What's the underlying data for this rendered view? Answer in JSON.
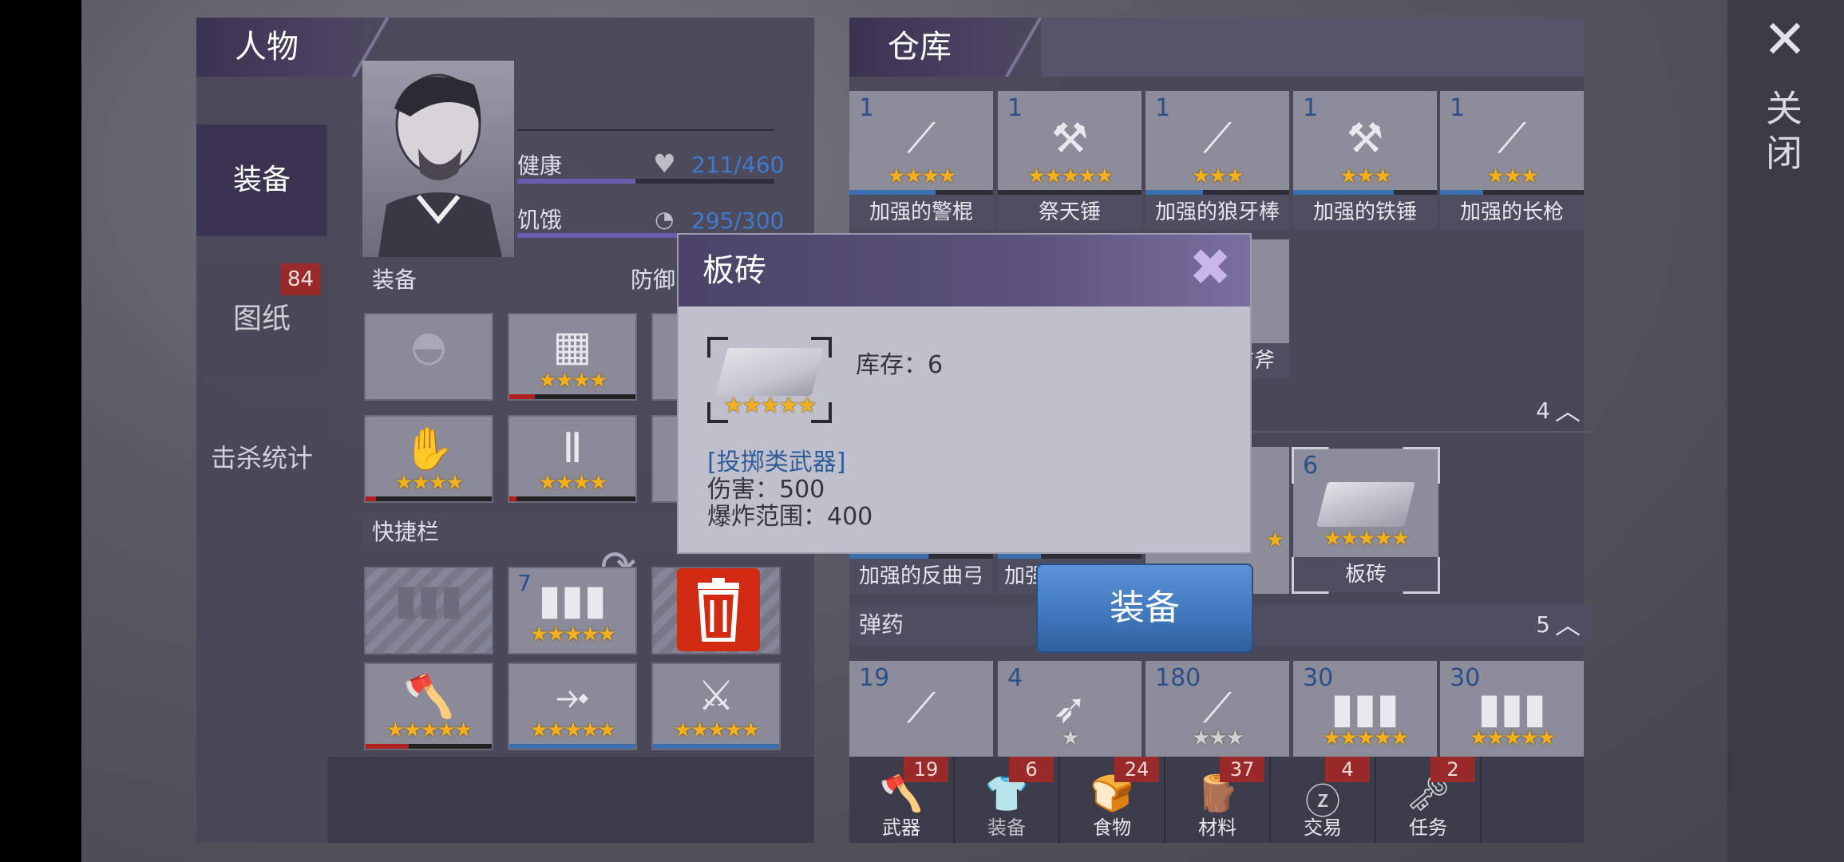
{
  "character": {
    "header": "人物",
    "nav": [
      {
        "label": "装备"
      },
      {
        "label": "图纸",
        "badge": "84"
      },
      {
        "label": "击杀统计"
      }
    ],
    "stats": [
      {
        "label": "健康",
        "icon": "heart-icon",
        "value": "211/460",
        "fill": 0.46
      },
      {
        "label": "饥饿",
        "icon": "stomach-icon",
        "value": "295/300",
        "fill": 0.98
      }
    ],
    "equip_label": "装备",
    "defense_label": "防御",
    "quickbar_label": "快捷栏",
    "quick_slots": [
      {
        "count": "",
        "icon": "ammo-icon",
        "stars": ""
      },
      {
        "count": "7",
        "icon": "ammo-icon",
        "stars": "★★★★★"
      },
      {
        "count": "",
        "icon": "trash-icon",
        "stars": ""
      },
      {
        "count": "",
        "icon": "axe-icon",
        "stars": "★★★★★"
      },
      {
        "count": "",
        "icon": "crossbow-icon",
        "stars": "★★★★★"
      },
      {
        "count": "",
        "icon": "sword-icon",
        "stars": "★★★★★"
      }
    ]
  },
  "warehouse": {
    "header": "仓库",
    "weapons": [
      {
        "count": "1",
        "name": "加强的警棍",
        "stars": "★★★★"
      },
      {
        "count": "1",
        "name": "祭天锤",
        "stars": "★★★★★"
      },
      {
        "count": "1",
        "name": "加强的狼牙棒",
        "stars": "★★★"
      },
      {
        "count": "1",
        "name": "加强的铁锤",
        "stars": "★★★"
      },
      {
        "count": "1",
        "name": "加强的长枪",
        "stars": "★★★"
      }
    ],
    "partial_axe_label": "防斧",
    "ranged_count": "4",
    "ranged_items": [
      {
        "name": "加强的反曲弓"
      },
      {
        "name": "加强"
      }
    ],
    "brick_item": {
      "count": "6",
      "name": "板砖",
      "stars": "★★★★★"
    },
    "ammo_header": "弹药",
    "ammo_count": "5",
    "ammo": [
      {
        "count": "19",
        "stars": ""
      },
      {
        "count": "4",
        "stars": "★"
      },
      {
        "count": "180",
        "stars": "★★★"
      },
      {
        "count": "30",
        "stars": "★★★★★"
      },
      {
        "count": "30",
        "stars": "★★★★★"
      }
    ],
    "tabs": [
      {
        "label": "武器",
        "badge": "19",
        "icon": "axe-icon"
      },
      {
        "label": "装备",
        "badge": "6",
        "icon": "shirt-icon"
      },
      {
        "label": "食物",
        "badge": "24",
        "icon": "bread-icon"
      },
      {
        "label": "材料",
        "badge": "37",
        "icon": "wood-icon"
      },
      {
        "label": "交易",
        "badge": "4",
        "icon": "coin-icon"
      },
      {
        "label": "任务",
        "badge": "2",
        "icon": "key-icon"
      }
    ]
  },
  "dialog": {
    "title": "板砖",
    "stock": "库存：6",
    "stars": "★★★★★",
    "type": "[投掷类武器]",
    "damage": "伤害：500",
    "range": "爆炸范围：400"
  },
  "equip_button": "装备",
  "close_label": "关闭",
  "colors": {
    "accent_blue": "#3f76bc",
    "star": "#f2b01e",
    "badge_red": "#9a2a2a"
  }
}
